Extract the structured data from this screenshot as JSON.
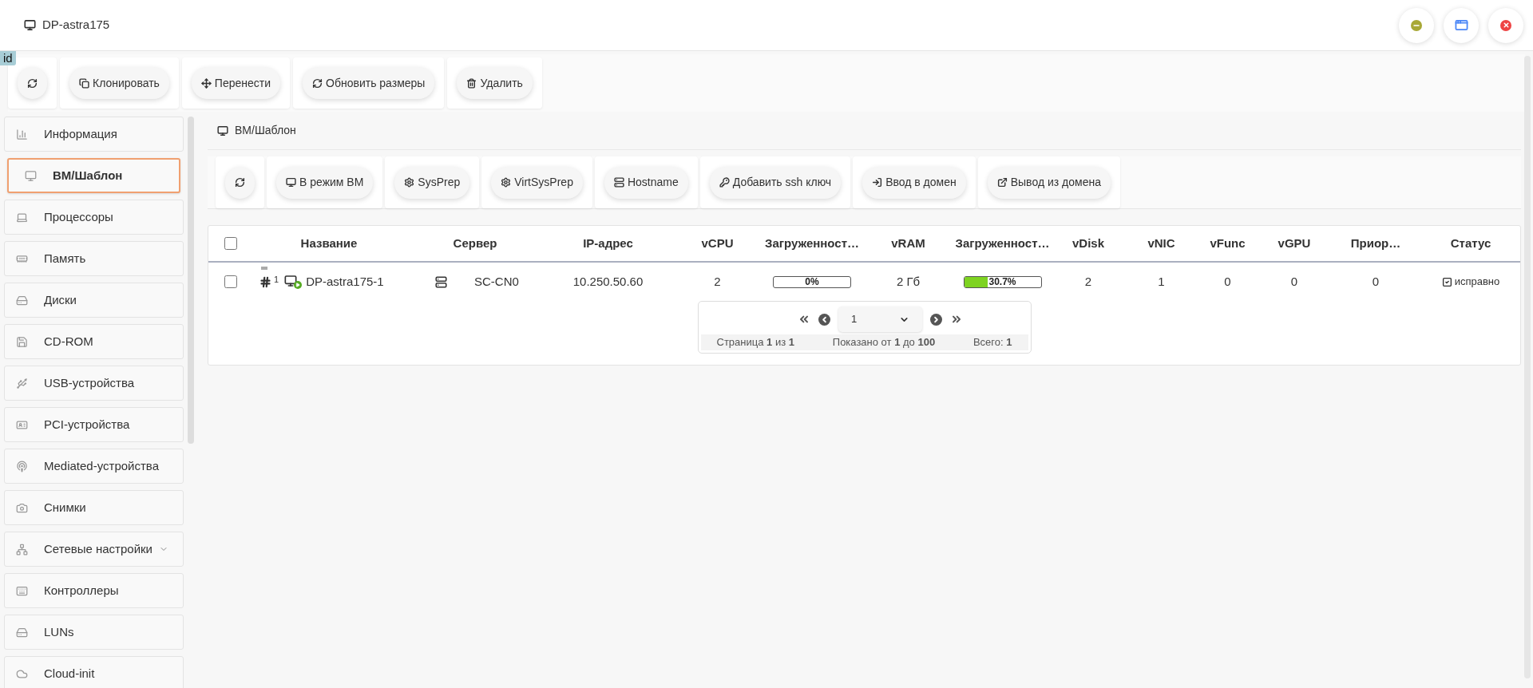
{
  "window": {
    "title": "DP-astra175"
  },
  "id_badge": "id",
  "toolbar": [
    {
      "kind": "icon"
    },
    {
      "kind": "text",
      "label": "Клонировать"
    },
    {
      "kind": "text",
      "label": "Перенести"
    },
    {
      "kind": "text",
      "label": "Обновить размеры"
    },
    {
      "kind": "text",
      "label": "Удалить"
    }
  ],
  "sidebar": {
    "items": [
      {
        "label": "Информация",
        "selected": false,
        "kind": "item"
      },
      {
        "label": "ВМ/Шаблон",
        "selected": true,
        "kind": "item"
      },
      {
        "label": "Процессоры",
        "selected": false,
        "kind": "item"
      },
      {
        "label": "Память",
        "selected": false,
        "kind": "item"
      },
      {
        "label": "Диски",
        "selected": false,
        "kind": "item"
      },
      {
        "label": "CD-ROM",
        "selected": false,
        "kind": "item"
      },
      {
        "label": "USB-устройства",
        "selected": false,
        "kind": "item"
      },
      {
        "label": "PCI-устройства",
        "selected": false,
        "kind": "item"
      },
      {
        "label": "Mediated-устройства",
        "selected": false,
        "kind": "item"
      },
      {
        "label": "Снимки",
        "selected": false,
        "kind": "item"
      },
      {
        "label": "Сетевые настройки",
        "selected": false,
        "kind": "submenu"
      },
      {
        "label": "Контроллеры",
        "selected": false,
        "kind": "item"
      },
      {
        "label": "LUNs",
        "selected": false,
        "kind": "item"
      },
      {
        "label": "Cloud-init",
        "selected": false,
        "kind": "item"
      }
    ]
  },
  "breadcrumb": "ВМ/Шаблон",
  "actions": [
    {
      "kind": "icon"
    },
    {
      "kind": "text",
      "label": "В режим ВМ"
    },
    {
      "kind": "text",
      "label": "SysPrep"
    },
    {
      "kind": "text",
      "label": "VirtSysPrep"
    },
    {
      "kind": "text",
      "label": "Hostname"
    },
    {
      "kind": "text",
      "label": "Добавить ssh ключ"
    },
    {
      "kind": "text",
      "label": "Ввод в домен"
    },
    {
      "kind": "text",
      "label": "Вывод из домена"
    }
  ],
  "table": {
    "header_checked": false,
    "columns": [
      "Название",
      "Сервер",
      "IP-адрес",
      "vCPU",
      "Загруженност…",
      "vRAM",
      "Загруженност…",
      "vDisk",
      "vNIC",
      "vFunc",
      "vGPU",
      "Приор…",
      "Статус"
    ],
    "rows": [
      {
        "checked": false,
        "number": "1",
        "name": "DP-astra175-1",
        "server": "SC-CN0",
        "ip": "10.250.50.60",
        "vcpu": "2",
        "cpu_load": {
          "level": 0,
          "reading": "0%"
        },
        "vram": "2 Гб",
        "ram_load": {
          "level": 0.307,
          "reading": "30.7%"
        },
        "vdisk": "2",
        "vnic": "1",
        "vfunc": "0",
        "vgpu": "0",
        "priority": "0",
        "status": "исправно"
      }
    ]
  },
  "pagination": {
    "page": "1",
    "page_info": "Страница **1** из **1**",
    "shown": "Показано от **1** до **100**",
    "total": "Всего: **1**"
  }
}
